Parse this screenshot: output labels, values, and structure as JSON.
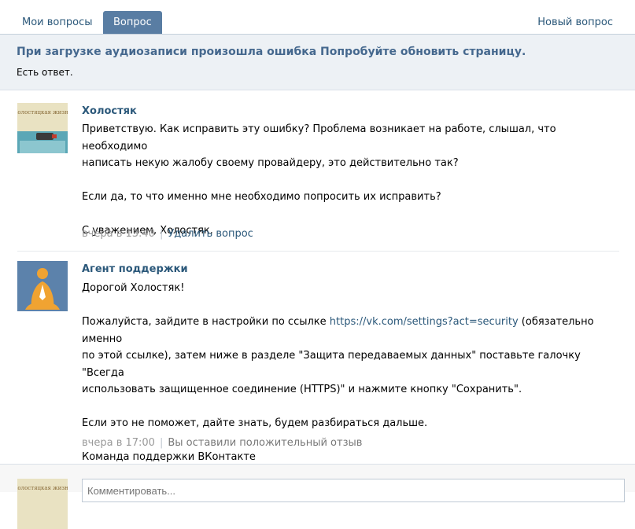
{
  "tabs": {
    "my_questions": "Мои вопросы",
    "question": "Вопрос",
    "new_question": "Новый вопрос"
  },
  "question": {
    "title": "При загрузке аудиозаписи произошла ошибка Попробуйте обновить страницу.",
    "status": "Есть ответ."
  },
  "messages": [
    {
      "author": "Холостяк",
      "avatar_caption": "Холостяцкая жизнь",
      "lines": [
        "Приветствую. Как исправить эту ошибку? Проблема возникает на работе, слышал, что необходимо",
        "написать некую жалобу своему провайдеру, это действительно так?",
        "Если да, то что именно мне необходимо попросить их исправить?",
        "С уважением, Холостяк."
      ],
      "time": "вчера в 13:40",
      "action": "Удалить вопрос"
    },
    {
      "author": "Агент поддержки",
      "lines": [
        "Дорогой Холостяк!",
        "Пожалуйста, зайдите в настройки по ссылке",
        "https://vk.com/settings?act=security",
        "(обязательно именно",
        "по этой ссылке), затем ниже в разделе \"Защита передаваемых данных\" поставьте галочку \"Всегда",
        "использовать защищенное соединение (HTTPS)\" и нажмите кнопку \"Сохранить\".",
        "Если это не поможет, дайте знать, будем разбираться дальше.",
        "Команда поддержки ВКонтакте"
      ],
      "time": "вчера в 17:00",
      "note": "Вы оставили положительный отзыв"
    }
  ],
  "reply": {
    "placeholder": "Комментировать..."
  },
  "colors": {
    "accent": "#597da3",
    "link": "#2b587a",
    "header_bg": "#edf1f5",
    "agent_avatar_bg": "#5c82ab",
    "agent_avatar_figure": "#f0a332"
  }
}
